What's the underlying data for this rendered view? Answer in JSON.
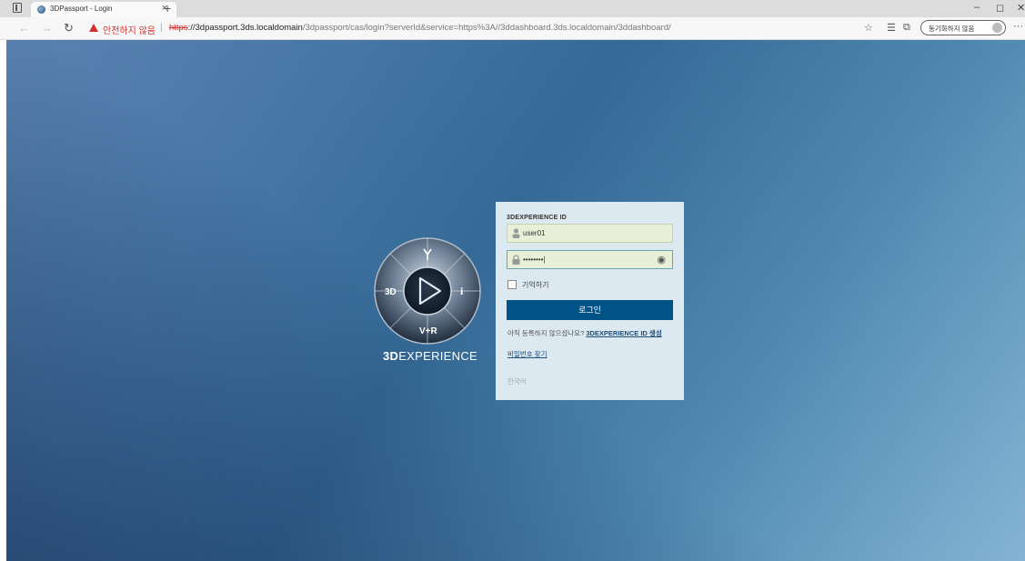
{
  "browser": {
    "tab_title": "3DPassport - Login",
    "tab_close": "×",
    "new_tab": "+",
    "security_warning": "안전하지 않음",
    "url_protocol": "https",
    "url_host": "://3dpassport.3ds.localdomain",
    "url_path": "/3dpassport/cas/login?serverId&service=https%3A//3ddashboard.3ds.localdomain/3ddashboard/",
    "private_label": "동기화하지 않음",
    "more": "···",
    "minimize": "–",
    "restore": "◻",
    "close": "✕"
  },
  "brand": {
    "name_bold": "3D",
    "name_rest": "EXPERIENCE",
    "compass_left": "3D",
    "compass_right": "i",
    "compass_bottom": "V+R"
  },
  "login": {
    "id_label": "3DEXPERIENCE ID",
    "username_value": "user01",
    "password_value": "••••••••|",
    "remember_label": "기억하기",
    "login_button": "로그인",
    "register_prompt": "아직 등록하지 않으셨나요? ",
    "register_link": "3DEXPERIENCE ID 생성",
    "forgot_link": "비밀번호 찾기",
    "language": "한국어"
  },
  "colors": {
    "login_button": "#005386",
    "warning": "#d32f2f",
    "card_bg": "#dce9f0"
  }
}
